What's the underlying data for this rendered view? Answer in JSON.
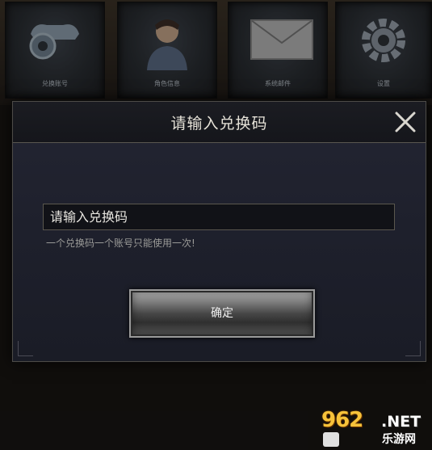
{
  "menu": {
    "tiles": [
      {
        "label": "兑换账号",
        "icon": "account-gear-icon"
      },
      {
        "label": "角色信息",
        "icon": "character-portrait-icon"
      },
      {
        "label": "系统邮件",
        "icon": "envelope-icon"
      },
      {
        "label": "设置",
        "icon": "gear-icon"
      }
    ]
  },
  "dialog": {
    "title": "请输入兑换码",
    "input_placeholder": "请输入兑换码",
    "input_value": "",
    "hint": "一个兑换码一个账号只能使用一次!",
    "confirm_label": "确定"
  },
  "watermark": {
    "main": "962",
    "net": ".NET",
    "sub": "乐游网"
  },
  "colors": {
    "modal_bg": "#1e202c",
    "border": "#5a574e",
    "title_text": "#e6e2d8",
    "watermark_gold": "#f6c23a"
  }
}
